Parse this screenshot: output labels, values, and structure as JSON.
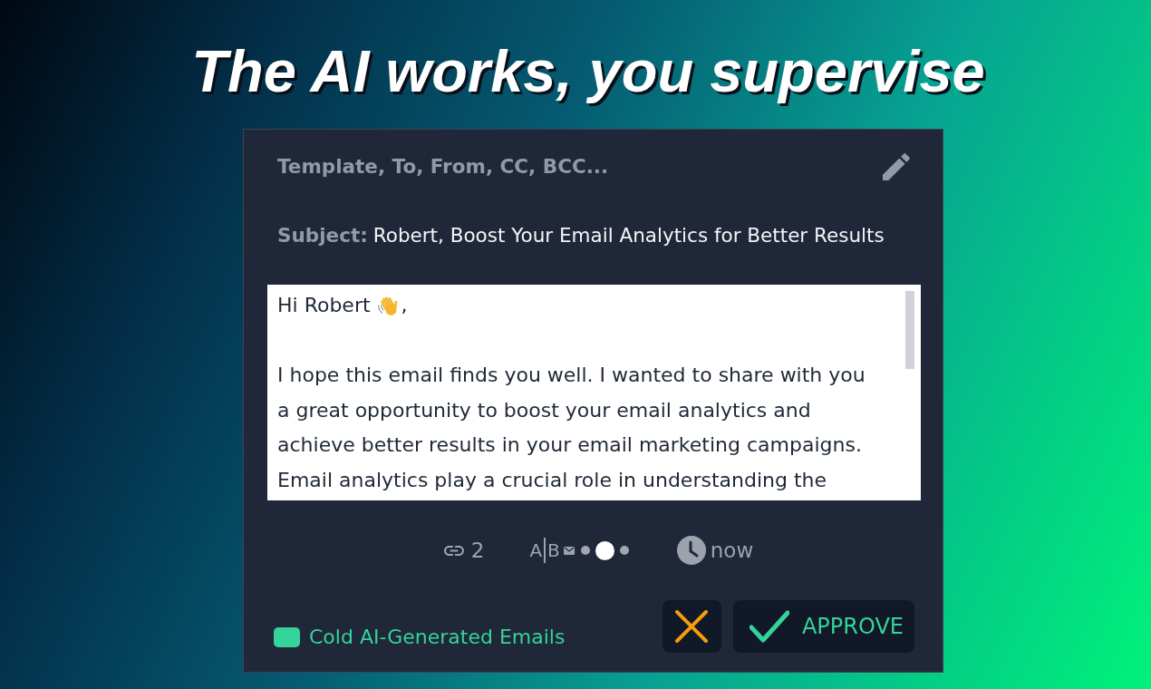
{
  "headline": "The AI works, you supervise",
  "email_card": {
    "recipients": "Template, To, From, CC, BCC...",
    "subject": {
      "label": "Subject:",
      "value": "Robert, Boost Your Email Analytics for Better Results"
    },
    "body": {
      "greeting": "Hi Robert",
      "greeting_end": ",",
      "paragraphs": [
        "I hope this email finds you well. I wanted to share with you a great opportunity to boost your email analytics and achieve better results in your email marketing campaigns. Email analytics play a crucial role in understanding the"
      ]
    },
    "stats": {
      "link_count": "2",
      "ab_test": {
        "label_a": "A",
        "label_b": "B",
        "variants": [
          {
            "selected": false
          },
          {
            "selected": true
          },
          {
            "selected": false
          }
        ]
      },
      "send_time": "now"
    },
    "tag": {
      "label": "Cold AI-Generated Emails",
      "color": "#34d399"
    },
    "actions": [
      {
        "kind": "reject"
      },
      {
        "kind": "approve",
        "label": "APPROVE"
      }
    ]
  }
}
